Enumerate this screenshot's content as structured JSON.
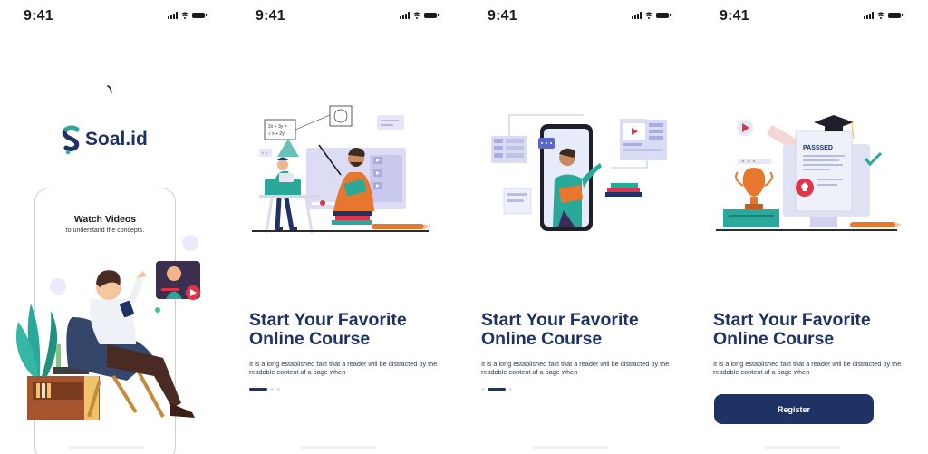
{
  "status": {
    "time": "9:41"
  },
  "splash": {
    "logo_text": "Soal.id",
    "phone_title": "Watch Videos",
    "phone_subtitle": "to understand the concepts."
  },
  "onboarding": {
    "title_line1": "Start Your Favorite",
    "title_line2": "Online Course",
    "description": "It is a long established fact that a reader will be distracted by the readable content of a page when"
  },
  "illustration": {
    "formula_line1": "2x + 3y =",
    "formula_line2": "√ x + 2y",
    "passed_label": "PASSSED"
  },
  "register": {
    "label": "Register"
  },
  "pagination": {
    "screen2_active": 0,
    "screen3_active": 1
  },
  "colors": {
    "primary": "#1f3266",
    "accent_orange": "#e7762e",
    "accent_green": "#2aa89a",
    "accent_red": "#e0344a"
  }
}
